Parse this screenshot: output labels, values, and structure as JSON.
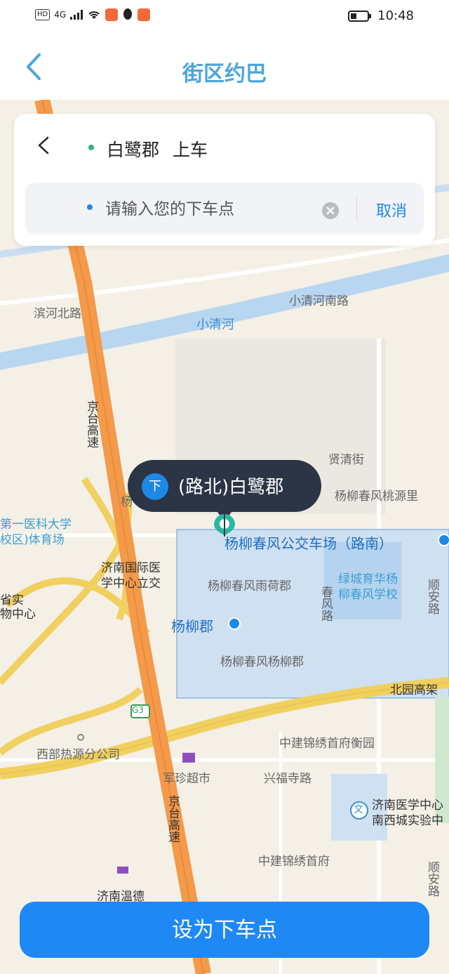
{
  "status_bar": {
    "time": "10:48",
    "network": "4G",
    "hd_label": "HD"
  },
  "header": {
    "title": "街区约巴"
  },
  "search_card": {
    "pickup_name": "白鹭郡",
    "pickup_tag": "上车",
    "dropoff_placeholder": "请输入您的下车点",
    "cancel_label": "取消"
  },
  "map": {
    "labels": {
      "binhe": "滨河北路",
      "xiaoqinghe": "小清河",
      "xiaoqinghe_road": "小清河南路",
      "jingtai1": "京台高速",
      "jingtai2": "京台高速",
      "xianqing": "贤清街",
      "taoyuan": "杨柳春风桃源里",
      "university": "第一医科大学",
      "university2": "校区)体育场",
      "gymnastic": "省实",
      "gym2": "物中心",
      "jinan_medical": "济南国际医",
      "jinan_medical2": "学中心立交",
      "busstop": "杨柳春风公交车场（路南）",
      "heyu": "杨柳春风雨荷郡",
      "lvcheng": "绿城育华杨",
      "lvcheng2": "柳春风学校",
      "shunan": "顺安路",
      "chunfeng": "春风路",
      "yangliu": "杨柳郡",
      "yangliu_jun": "杨柳春风杨柳郡",
      "beiyuan": "北园高架",
      "g3": "G3",
      "xibu": "西部热源分公司",
      "zhongjian1": "中建锦绣首府衡园",
      "xingfusi": "兴福寺路",
      "junzhen": "军珍超市",
      "jinan_school": "济南医学中心",
      "jinan_school2": "南西城实验中",
      "zhongjian2": "中建锦绣首府",
      "jinanwende": "济南温德",
      "shunan2": "顺安路",
      "yangliu_short": "杨",
      "shunan_a": "顺",
      "wen_icon": "文"
    }
  },
  "marker": {
    "icon_label": "下",
    "text": "(路北)白鹭郡"
  },
  "cta": {
    "label": "设为下车点"
  },
  "colors": {
    "accent": "#1e88f5",
    "title": "#4aa6d9",
    "pickup_dot": "#2ab77a",
    "bubble": "#2c3545"
  }
}
